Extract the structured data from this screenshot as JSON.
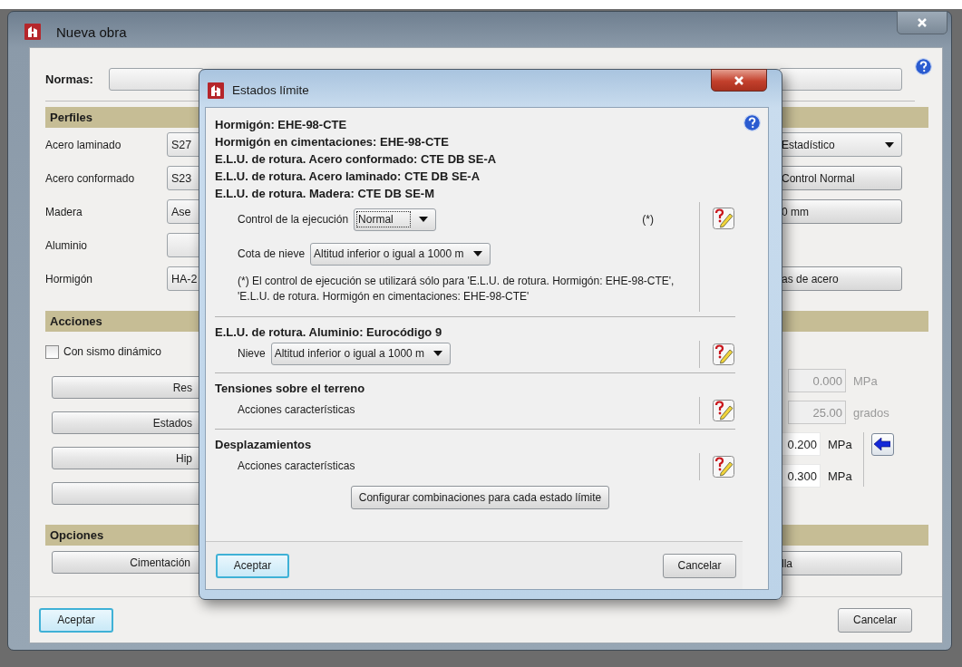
{
  "main_window": {
    "title": "Nueva obra",
    "normas": {
      "label": "Normas:"
    },
    "sections": [
      {
        "kind": "rows",
        "title": "Perfiles",
        "rows": [
          {
            "label": "Acero laminado",
            "value": "S27",
            "right": {
              "kind": "select",
              "text": "Estadístico"
            }
          },
          {
            "label": "Acero conformado",
            "value": "S23",
            "right": {
              "kind": "button",
              "text": "Control Normal"
            }
          },
          {
            "label": "Madera",
            "value": "Ase",
            "right": {
              "kind": "button",
              "text": "0 mm"
            }
          },
          {
            "label": "Aluminio"
          },
          {
            "label": "Hormigón",
            "value": "HA-2",
            "right": {
              "kind": "button",
              "text": "as de acero"
            }
          }
        ]
      },
      {
        "kind": "columns",
        "title": "Acciones",
        "left": [
          {
            "kind": "checkbox",
            "label": "Con sismo dinámico",
            "checked": false
          },
          {
            "kind": "button",
            "label": "Res"
          },
          {
            "kind": "button",
            "label": "Estados"
          },
          {
            "kind": "button",
            "label": "Hip"
          },
          {
            "kind": "button"
          }
        ],
        "right": [
          {
            "kind": "stat",
            "value": "0.000",
            "unit": "MPa",
            "disabled": true
          },
          {
            "kind": "stat",
            "value": "25.00",
            "unit": "grados",
            "disabled": true
          },
          {
            "kind": "stat",
            "value": "0.200",
            "unit": "MPa",
            "disabled": false,
            "arrow": true
          },
          {
            "kind": "stat",
            "value": "0.300",
            "unit": "MPa",
            "disabled": false
          }
        ]
      },
      {
        "kind": "columns",
        "title": "Opciones",
        "left": [
          {
            "kind": "button",
            "label": "Cimentación"
          }
        ],
        "right": [
          {
            "kind": "button",
            "label": "lla"
          }
        ]
      }
    ],
    "buttons": [
      {
        "label": "Aceptar",
        "default": true
      },
      {
        "label": "Cancelar",
        "default": false
      }
    ]
  },
  "dialog": {
    "title": "Estados límite",
    "sections": [
      {
        "headings": [
          "Hormigón: EHE-98-CTE",
          "Hormigón en cimentaciones: EHE-98-CTE",
          "E.L.U. de rotura. Acero conformado: CTE DB SE-A",
          "E.L.U. de rotura. Acero laminado: CTE DB SE-A",
          "E.L.U. de rotura. Madera: CTE DB SE-M"
        ],
        "rows": [
          {
            "kind": "select",
            "label": "Control de la ejecución",
            "value": "Normal",
            "focused": true,
            "mark": "(*)"
          },
          {
            "kind": "select",
            "label": "Cota de nieve",
            "value": "Altitud inferior o igual a 1000 m",
            "focused": false
          }
        ],
        "note": "(*) El control de ejecución se utilizará sólo para 'E.L.U. de rotura. Hormigón: EHE-98-CTE', 'E.L.U. de rotura. Hormigón en cimentaciones: EHE-98-CTE'"
      },
      {
        "headings": [
          "E.L.U. de rotura. Aluminio: Eurocódigo 9"
        ],
        "rows": [
          {
            "kind": "select",
            "label": "Nieve",
            "value": "Altitud inferior o igual a 1000 m",
            "focused": false
          }
        ]
      },
      {
        "headings": [
          "Tensiones sobre el terreno"
        ],
        "rows": [
          {
            "kind": "text",
            "label": "Acciones características"
          }
        ]
      },
      {
        "headings": [
          "Desplazamientos"
        ],
        "rows": [
          {
            "kind": "text",
            "label": "Acciones características"
          }
        ]
      }
    ],
    "config_button": "Configurar combinaciones para cada estado límite",
    "buttons": [
      {
        "label": "Aceptar",
        "default": true
      },
      {
        "label": "Cancelar",
        "default": false
      }
    ]
  }
}
